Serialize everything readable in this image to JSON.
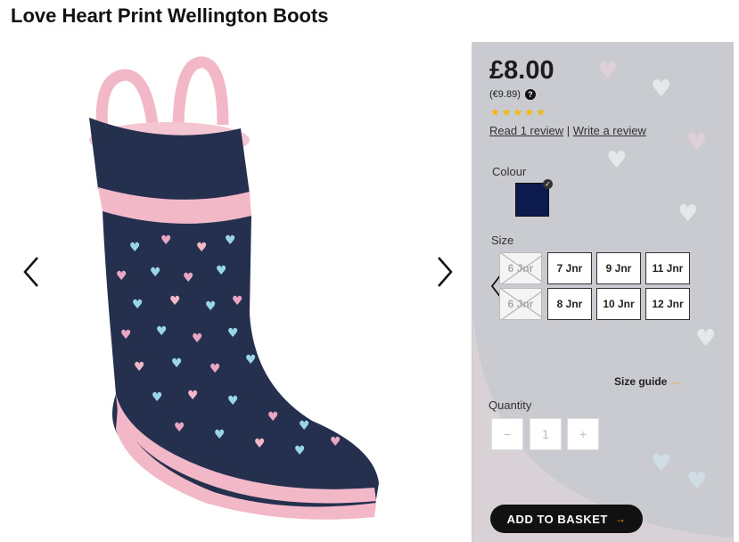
{
  "product": {
    "title": "Love Heart Print Wellington Boots",
    "price": "£8.00",
    "price_eur": "(€9.89)",
    "help_glyph": "?",
    "rating_stars": 5,
    "rating_max": 5,
    "read_reviews": "Read 1 review",
    "review_separator": "|",
    "write_review": "Write a review"
  },
  "colour": {
    "label": "Colour",
    "selected_swatch": "#0c1a4d",
    "check_glyph": "✓"
  },
  "sizes": {
    "label": "Size",
    "row1": [
      {
        "label": "6 Jnr",
        "available": false
      },
      {
        "label": "7 Jnr",
        "available": true
      },
      {
        "label": "9 Jnr",
        "available": true
      },
      {
        "label": "11 Jnr",
        "available": true
      }
    ],
    "row2": [
      {
        "label": "6 Jnr",
        "available": false
      },
      {
        "label": "8 Jnr",
        "available": true
      },
      {
        "label": "10 Jnr",
        "available": true
      },
      {
        "label": "12 Jnr",
        "available": true
      }
    ],
    "guide": "Size guide",
    "guide_arrow": "→"
  },
  "quantity": {
    "label": "Quantity",
    "minus": "−",
    "value": "1",
    "plus": "+"
  },
  "basket": {
    "label": "ADD TO BASKET",
    "arrow": "→"
  },
  "icons": {
    "gallery_prev": "chevron-left-icon",
    "gallery_next": "chevron-right-icon",
    "size_prev": "chevron-left-icon"
  },
  "colors": {
    "boot_navy": "#25304f",
    "boot_pink": "#f2b8c8",
    "star": "#f5b700",
    "accent_orange": "#f5a300",
    "panel_bg": "#c9cbd1"
  }
}
